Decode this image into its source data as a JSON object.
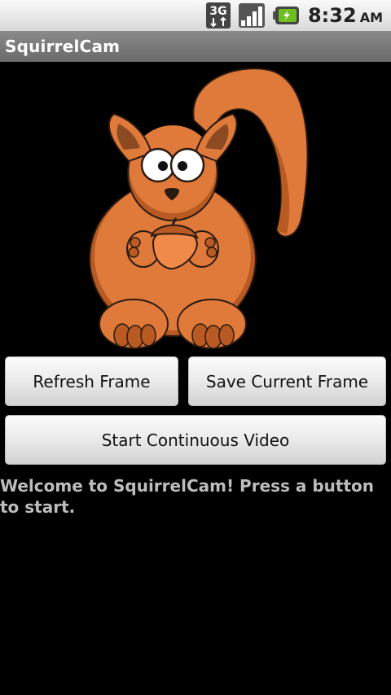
{
  "status_bar": {
    "network_type": "3G",
    "time": "8:32",
    "ampm": "AM",
    "icons": [
      "3g-data-icon",
      "signal-strength-icon",
      "battery-charging-icon"
    ]
  },
  "app": {
    "title": "SquirrelCam"
  },
  "buttons": {
    "refresh": "Refresh Frame",
    "save": "Save Current Frame",
    "video": "Start Continuous Video"
  },
  "message": "Welcome to SquirrelCam! Press a button to start.",
  "colors": {
    "squirrel_body": "#e07a3a",
    "squirrel_shadow": "#b85a22",
    "button_text": "#111111",
    "message_text": "#bdbdbd",
    "title_bar": "#7a7a7a"
  }
}
